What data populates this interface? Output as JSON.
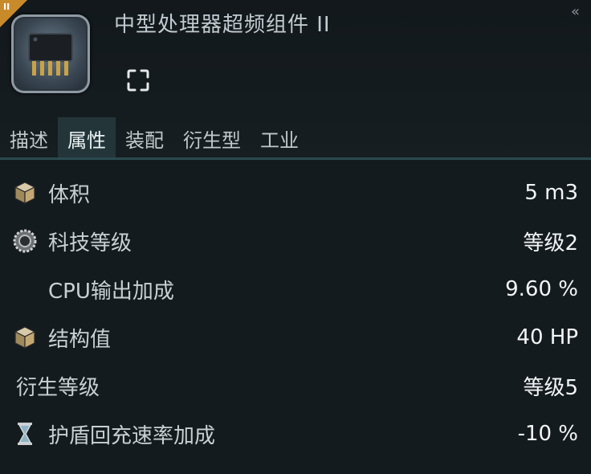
{
  "header": {
    "title": "中型处理器超频组件 II",
    "tech_level_badge": "II",
    "collapse_glyph": "«",
    "item_icon": "processor-chip-icon",
    "target_icon": "target-bracket-icon"
  },
  "tabs": [
    {
      "label": "描述",
      "active": false
    },
    {
      "label": "属性",
      "active": true
    },
    {
      "label": "装配",
      "active": false
    },
    {
      "label": "衍生型",
      "active": false
    },
    {
      "label": "工业",
      "active": false
    }
  ],
  "attributes": [
    {
      "icon": "cube-icon",
      "label": "体积",
      "value": "5 m3"
    },
    {
      "icon": "gear-icon",
      "label": "科技等级",
      "value": "等级2"
    },
    {
      "icon": "",
      "label": "CPU输出加成",
      "value": "9.60 %"
    },
    {
      "icon": "cube-icon",
      "label": "结构值",
      "value": "40 HP"
    },
    {
      "icon": "",
      "label": "衍生等级",
      "value": "等级5"
    },
    {
      "icon": "hourglass-icon",
      "label": "护盾回充速率加成",
      "value": "-10 %"
    }
  ],
  "colors": {
    "background": "#141b1f",
    "tab_active": "#24353a",
    "tab_underline": "#2a4a4e",
    "badge": "#c98b2a"
  }
}
